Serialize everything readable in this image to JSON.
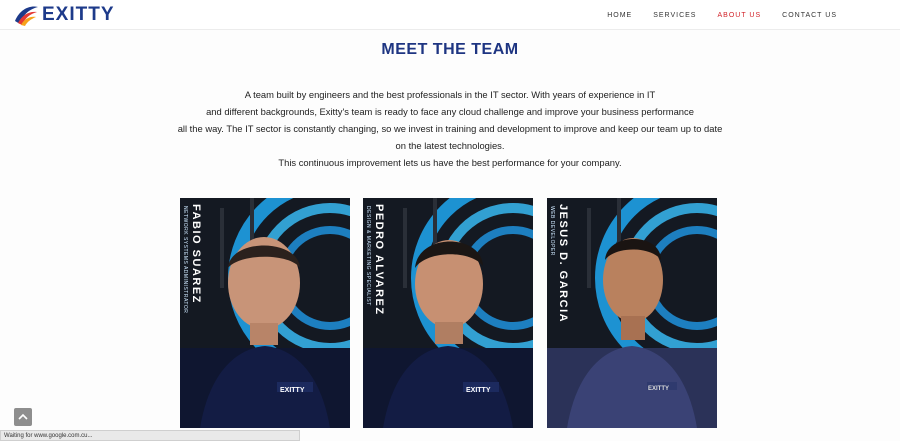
{
  "brand": {
    "name": "EXITTY"
  },
  "nav": {
    "items": [
      {
        "label": "HOME",
        "active": false
      },
      {
        "label": "SERVICES",
        "active": false
      },
      {
        "label": "ABOUT US",
        "active": true
      },
      {
        "label": "CONTACT US",
        "active": false
      }
    ],
    "active_color": "#d2232a"
  },
  "main": {
    "title": "MEET THE TEAM",
    "intro_lines": [
      "A team built by engineers and the best professionals in the IT sector. With years of experience in IT",
      "and different backgrounds, Exitty's team is ready to face any cloud challenge and improve your business performance",
      "all the way. The IT sector is constantly changing, so we invest in training and development to improve and keep our team up to date",
      "on the latest technologies.",
      "This continuous improvement lets us have the best performance for your company."
    ]
  },
  "team": [
    {
      "name": "FABIO SUAREZ",
      "role": "NETWORK SYSTEMS ADMINISTRATOR",
      "shirt_logo": "EXITTY"
    },
    {
      "name": "PEDRO ALVAREZ",
      "role": "DESIGN & MARKETING SPECIALIST",
      "shirt_logo": "EXITTY"
    },
    {
      "name": "JESUS D. GARCIA",
      "role": "WEB DEVELOPER",
      "shirt_logo": "EXITTY"
    }
  ],
  "status_bar": {
    "text": "Waiting for www.google.com.cu..."
  },
  "icons": {
    "scroll_top": "chevron-up-icon",
    "logo_mark": "swoosh-logo-icon"
  },
  "colors": {
    "title": "#1e3582",
    "brand": "#1d3a8a",
    "card_accent": "#1ea0e6"
  }
}
